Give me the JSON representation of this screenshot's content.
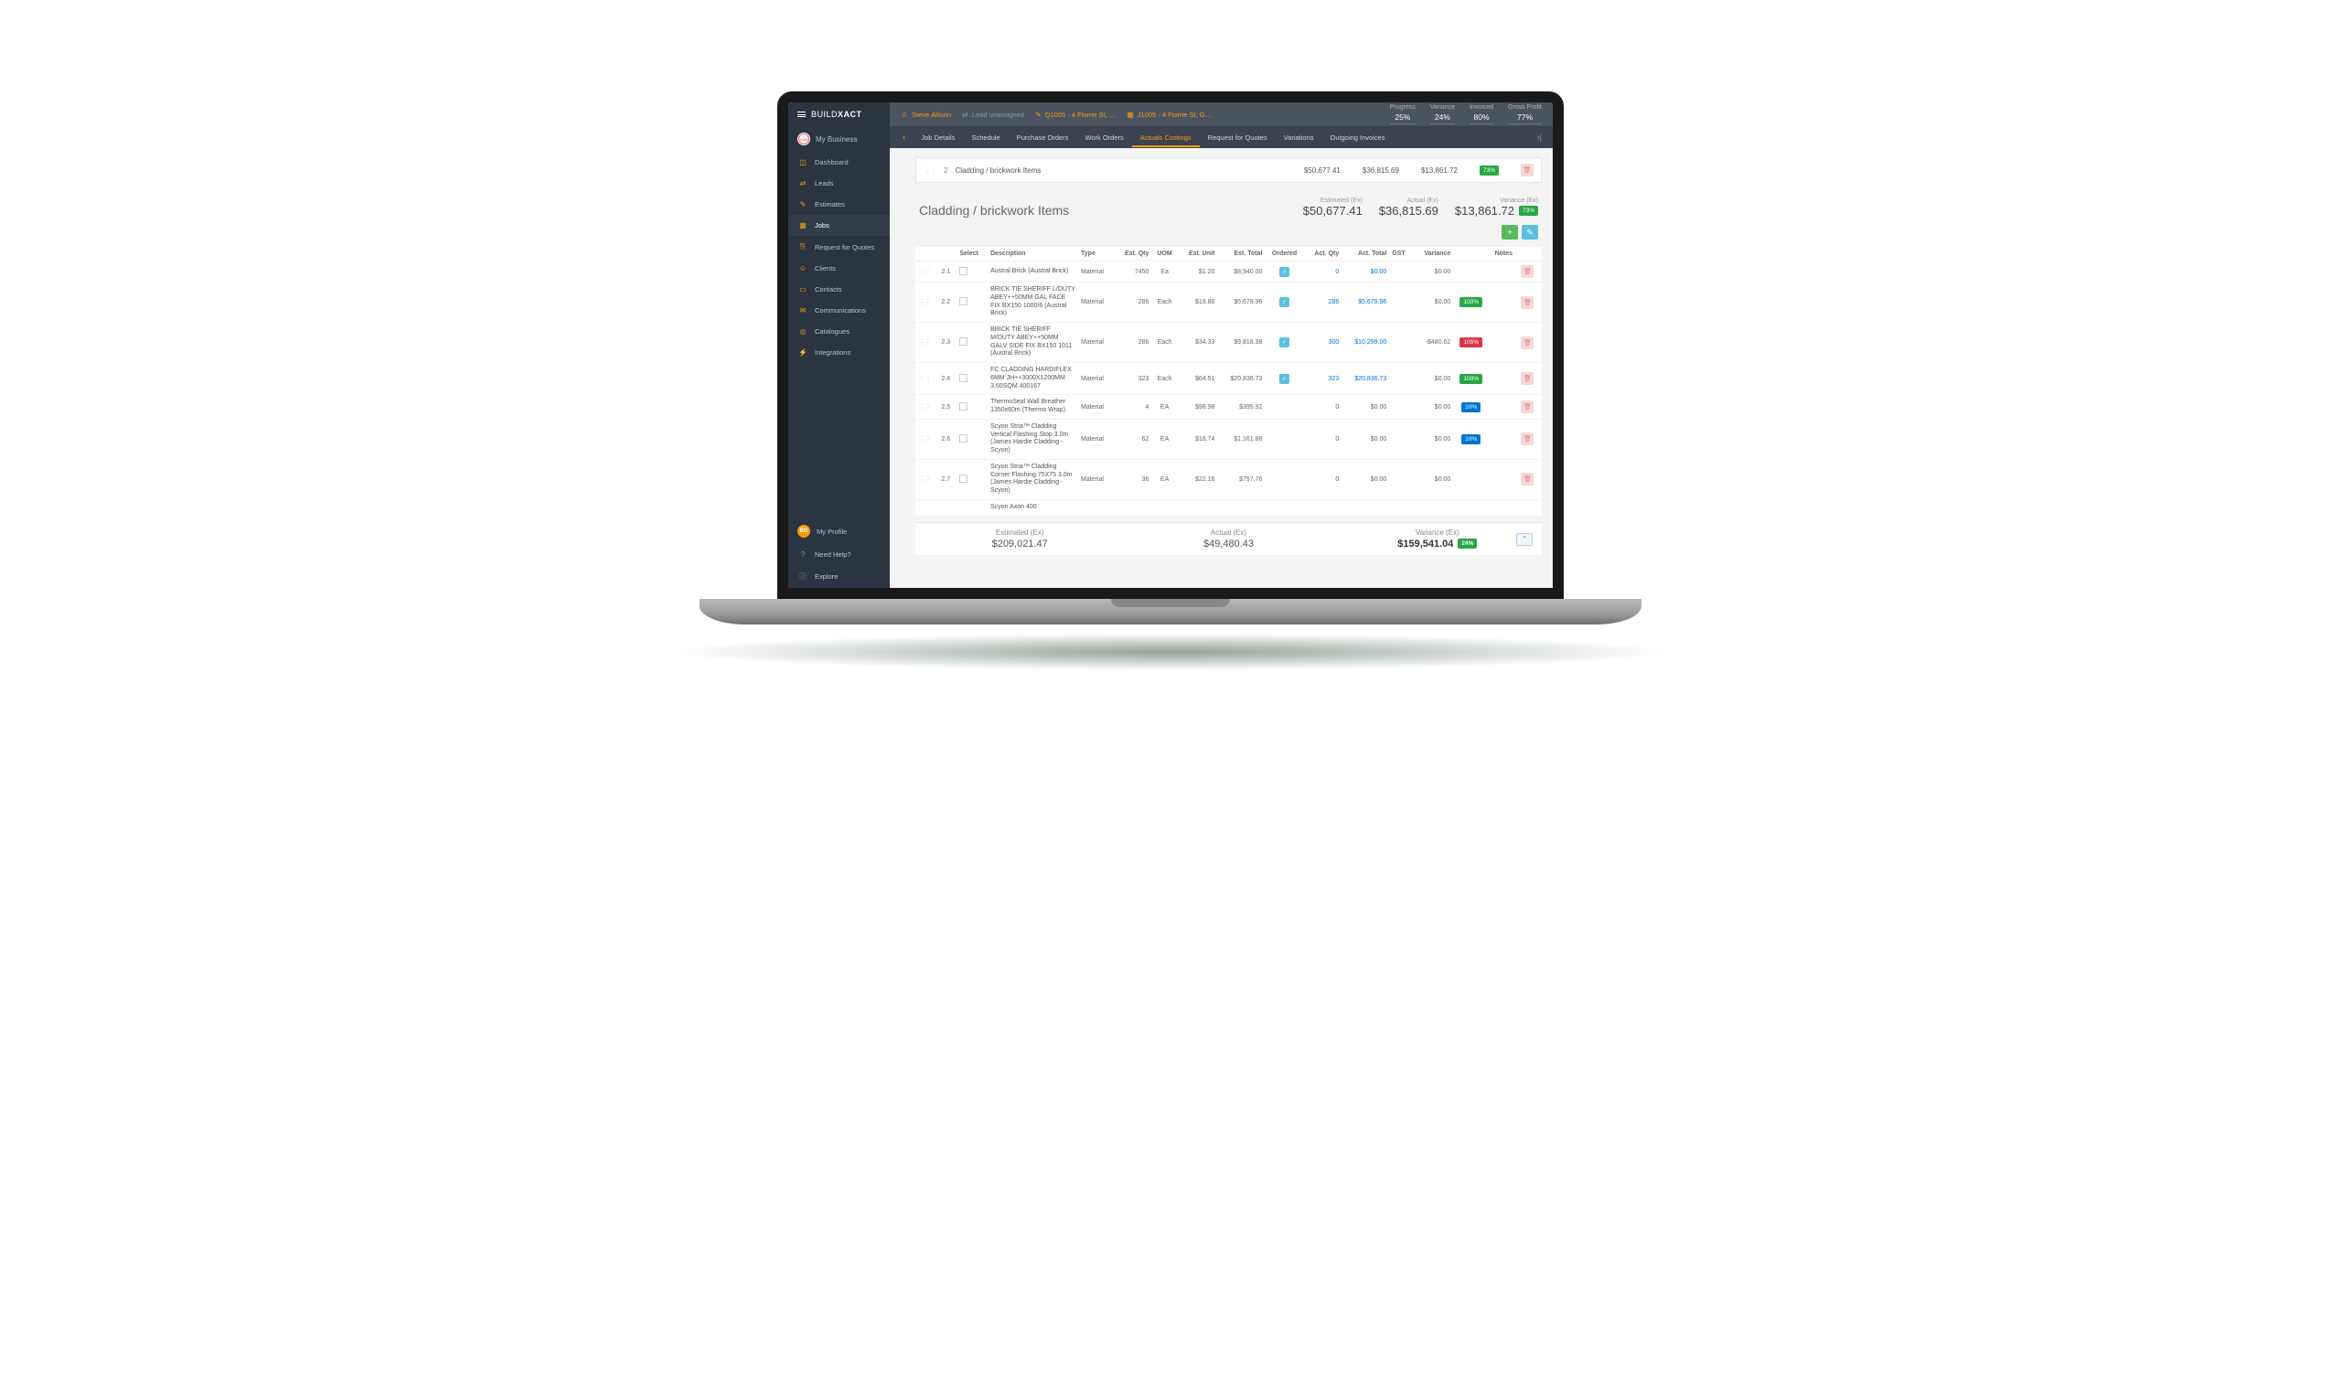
{
  "brand": {
    "a": "BUILD",
    "b": "XACT"
  },
  "myBusiness": "My Business",
  "sidebar": [
    {
      "icon": "◫",
      "label": "Dashboard"
    },
    {
      "icon": "⇄",
      "label": "Leads"
    },
    {
      "icon": "✎",
      "label": "Estimates"
    },
    {
      "icon": "▦",
      "label": "Jobs",
      "active": true
    },
    {
      "icon": "⎘",
      "label": "Request for Quotes"
    },
    {
      "icon": "☺",
      "label": "Clients"
    },
    {
      "icon": "▭",
      "label": "Contacts"
    },
    {
      "icon": "✉",
      "label": "Communications"
    },
    {
      "icon": "◎",
      "label": "Catalogues"
    },
    {
      "icon": "⚡",
      "label": "Integrations"
    }
  ],
  "sidebarBottom": [
    {
      "icon": "BD",
      "label": "My Profile",
      "avatar": true
    },
    {
      "icon": "?",
      "label": "Need Help?"
    },
    {
      "icon": "ⓘ",
      "label": "Explore"
    }
  ],
  "crumbs": [
    {
      "icon": "☺",
      "text": "Steve Allison"
    },
    {
      "icon": "⇄",
      "text": "Lead unassigned",
      "muted": true
    },
    {
      "icon": "✎",
      "text": "Q1005 - 4 Florrie St, …"
    },
    {
      "icon": "▦",
      "text": "J1005 - 4 Florrie St, G…"
    }
  ],
  "topStats": [
    {
      "label": "Progress",
      "value": "25%"
    },
    {
      "label": "Variance",
      "value": "24%"
    },
    {
      "label": "Invoiced",
      "value": "80%"
    },
    {
      "label": "Gross Profit",
      "value": "77%"
    }
  ],
  "tabs": [
    "Job Details",
    "Schedule",
    "Purchase Orders",
    "Work Orders",
    "Actuals Costings",
    "Request for Quotes",
    "Variations",
    "Outgoing Invoices"
  ],
  "activeTab": 4,
  "category": {
    "num": "2",
    "title": "Cladding / brickwork Items",
    "estimated": "$50,677.41",
    "actual": "$36,815.69",
    "variance": "$13,861.72",
    "variancePct": "73%"
  },
  "sectionTotals": {
    "estLbl": "Estimated (Ex)",
    "est": "$50,677.41",
    "actLbl": "Actual (Ex)",
    "act": "$36,815.69",
    "varLbl": "Variance (Ex)",
    "var": "$13,861.72",
    "varPct": "73%"
  },
  "columns": [
    "",
    "",
    "Select",
    "Description",
    "Type",
    "Est. Qty",
    "UOM",
    "Est. Unit",
    "Est. Total",
    "Ordered",
    "Act. Qty",
    "Act. Total",
    "GST",
    "Variance",
    "",
    "Notes",
    ""
  ],
  "rows": [
    {
      "id": "2.1",
      "desc": "Austral Brick (Austral Brick)",
      "type": "Material",
      "eqty": "7450",
      "uom": "Ea",
      "eunit": "$1.20",
      "etot": "$8,940.00",
      "ordered": true,
      "aqty": "0",
      "atot": "$0.00",
      "var": "$0.00",
      "varBadge": ""
    },
    {
      "id": "2.2",
      "desc": "BRICK TIE SHERIFF L/DUTY ABEY++50MM GAL FACE FIX BX150 1000/6 (Austral Brick)",
      "type": "Material",
      "eqty": "286",
      "uom": "Each",
      "eunit": "$19.86",
      "etot": "$5,679.96",
      "ordered": true,
      "aqty": "286",
      "atot": "$5,679.96",
      "var": "$0.00",
      "varBadge": "100%",
      "badgeCls": ""
    },
    {
      "id": "2.3",
      "desc": "BRICK TIE SHERIFF M/DUTY ABEY++50MM GALV SIDE FIX BX150 1011 (Austral Brick)",
      "type": "Material",
      "eqty": "286",
      "uom": "Each",
      "eunit": "$34.33",
      "etot": "$9,818.38",
      "ordered": true,
      "aqty": "300",
      "atot": "$10,299.00",
      "var": "-$480.62",
      "varBadge": "105%",
      "badgeCls": "red"
    },
    {
      "id": "2.4",
      "desc": "FC CLADDING HARDIFLEX 6MM JH++3000X1200MM 3.60SQM 400167",
      "type": "Material",
      "eqty": "323",
      "uom": "Each",
      "eunit": "$64.51",
      "etot": "$20,836.73",
      "ordered": true,
      "aqty": "323",
      "atot": "$20,836.73",
      "var": "$0.00",
      "varBadge": "100%",
      "badgeCls": ""
    },
    {
      "id": "2.5",
      "desc": "ThermoSeal Wall Breather 1350x60m (Thermo Wrap)",
      "type": "Material",
      "eqty": "4",
      "uom": "EA",
      "eunit": "$98.98",
      "etot": "$395.92",
      "ordered": false,
      "aqty": "0",
      "atot": "$0.00",
      "var": "$0.00",
      "varBadge": "10%",
      "badgeCls": "blue"
    },
    {
      "id": "2.6",
      "desc": "Scyon Stria™ Cladding Vertical Flashing Stop 3.0m (James Hardie Cladding - Scyon)",
      "type": "Material",
      "eqty": "62",
      "uom": "EA",
      "eunit": "$18.74",
      "etot": "$1,161.88",
      "ordered": false,
      "aqty": "0",
      "atot": "$0.00",
      "var": "$0.00",
      "varBadge": "10%",
      "badgeCls": "blue"
    },
    {
      "id": "2.7",
      "desc": "Scyon Stria™ Cladding Corner Flashing 75X75 3.0m (James Hardie Cladding - Scyon)",
      "type": "Material",
      "eqty": "36",
      "uom": "EA",
      "eunit": "$22.16",
      "etot": "$797.76",
      "ordered": false,
      "aqty": "0",
      "atot": "$0.00",
      "var": "$0.00",
      "varBadge": "",
      "badgeCls": ""
    }
  ],
  "truncatedRow": "Scyon Axon 400",
  "footer": {
    "estLbl": "Estimated (Ex)",
    "est": "$209,021.47",
    "actLbl": "Actual (Ex)",
    "act": "$49,480.43",
    "varLbl": "Variance (Ex)",
    "var": "$159,541.04",
    "varPct": "24%"
  }
}
